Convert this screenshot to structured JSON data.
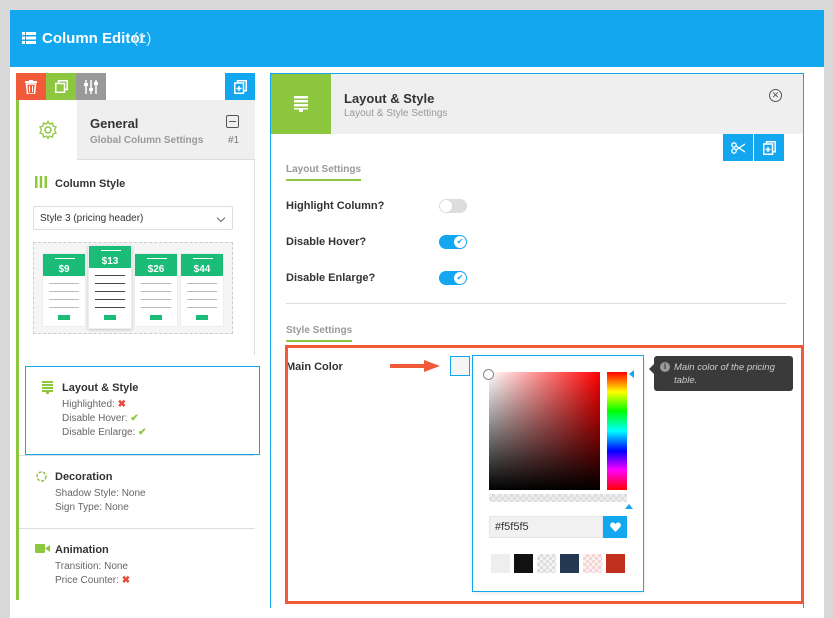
{
  "header": {
    "title": "Column Editor",
    "count": "(1)"
  },
  "left_tabs": [
    {
      "name": "trash-icon"
    },
    {
      "name": "copy-icon"
    },
    {
      "name": "sliders-icon"
    },
    {
      "name": "add-page-icon"
    }
  ],
  "general": {
    "title": "General",
    "subtitle": "Global Column Settings",
    "number": "#1"
  },
  "column_style": {
    "title": "Column Style",
    "selected": "Style 3 (pricing header)",
    "preview_prices": [
      "$9",
      "$13",
      "$26",
      "$44"
    ]
  },
  "sidebar": {
    "layout": {
      "title": "Layout & Style",
      "lines": [
        {
          "label": "Highlighted:",
          "mark": "✖"
        },
        {
          "label": "Disable Hover:",
          "mark": "✔"
        },
        {
          "label": "Disable Enlarge:",
          "mark": "✔"
        }
      ]
    },
    "decoration": {
      "title": "Decoration",
      "lines": [
        "Shadow Style: None",
        "Sign Type: None"
      ]
    },
    "animation": {
      "title": "Animation",
      "line1": "Transition: None",
      "line2_label": "Price Counter:",
      "line2_mark": "✖"
    }
  },
  "panel": {
    "title": "Layout & Style",
    "subtitle": "Layout & Style Settings",
    "close": "✕",
    "layout_section": "Layout Settings",
    "settings": [
      {
        "label": "Highlight Column?",
        "on": false
      },
      {
        "label": "Disable Hover?",
        "on": true
      },
      {
        "label": "Disable Enlarge?",
        "on": true
      }
    ],
    "style_section": "Style Settings",
    "main_color_label": "Main Color"
  },
  "color_picker": {
    "hex": "#f5f5f5",
    "favorite_icon": "heart-icon",
    "palette": [
      "#eeeeee",
      "#111111",
      "transparent",
      "#253a52",
      "transparent-pink",
      "#c0301d"
    ]
  },
  "tooltip": {
    "text": "Main color of the pricing table.",
    "icon": "i"
  },
  "colors": {
    "accent": "#13a7f0",
    "green": "#8dc63f",
    "red": "#f05a3a"
  }
}
